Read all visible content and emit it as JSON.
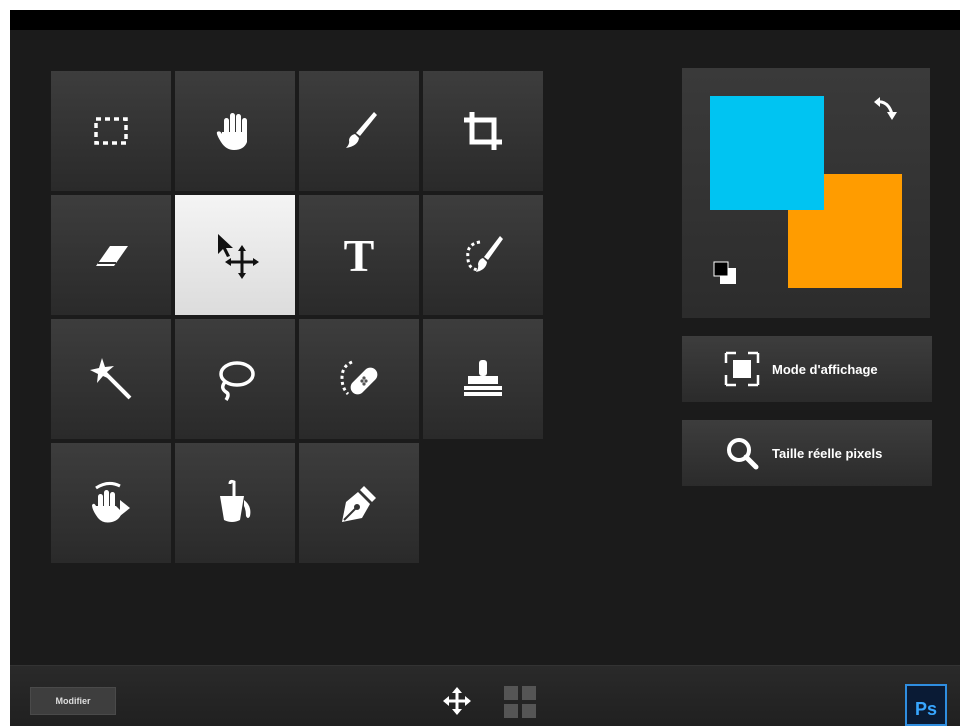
{
  "tools": [
    {
      "name": "selection-rectangle",
      "icon": "marquee-icon",
      "selected": false
    },
    {
      "name": "hand",
      "icon": "hand-icon",
      "selected": false
    },
    {
      "name": "brush",
      "icon": "brush-icon",
      "selected": false
    },
    {
      "name": "crop",
      "icon": "crop-icon",
      "selected": false
    },
    {
      "name": "eraser",
      "icon": "eraser-icon",
      "selected": false
    },
    {
      "name": "move",
      "icon": "move-arrow-icon",
      "selected": true
    },
    {
      "name": "text",
      "icon": "text-icon",
      "selected": false
    },
    {
      "name": "quick-selection",
      "icon": "quick-selection-icon",
      "selected": false
    },
    {
      "name": "magic-wand",
      "icon": "magic-wand-icon",
      "selected": false
    },
    {
      "name": "lasso",
      "icon": "lasso-icon",
      "selected": false
    },
    {
      "name": "healing-brush",
      "icon": "bandage-icon",
      "selected": false
    },
    {
      "name": "clone-stamp",
      "icon": "stamp-icon",
      "selected": false
    },
    {
      "name": "smudge",
      "icon": "smudge-hand-icon",
      "selected": false
    },
    {
      "name": "paint-bucket",
      "icon": "bucket-icon",
      "selected": false
    },
    {
      "name": "pen",
      "icon": "pen-nib-icon",
      "selected": false
    }
  ],
  "text_tool_glyph": "T",
  "colors": {
    "foreground": "#00c4f2",
    "background": "#ff9c00"
  },
  "side_buttons": {
    "display_mode": {
      "label": "Mode d'affichage",
      "icon": "screen-mode-icon"
    },
    "actual_pixels": {
      "label": "Taille réelle pixels",
      "icon": "magnifier-icon"
    }
  },
  "bottom_bar": {
    "modify_label": "Modifier",
    "move_icon": "pan-arrows-icon",
    "grid_icon": "grid-view-icon",
    "app_logo": "Ps"
  }
}
